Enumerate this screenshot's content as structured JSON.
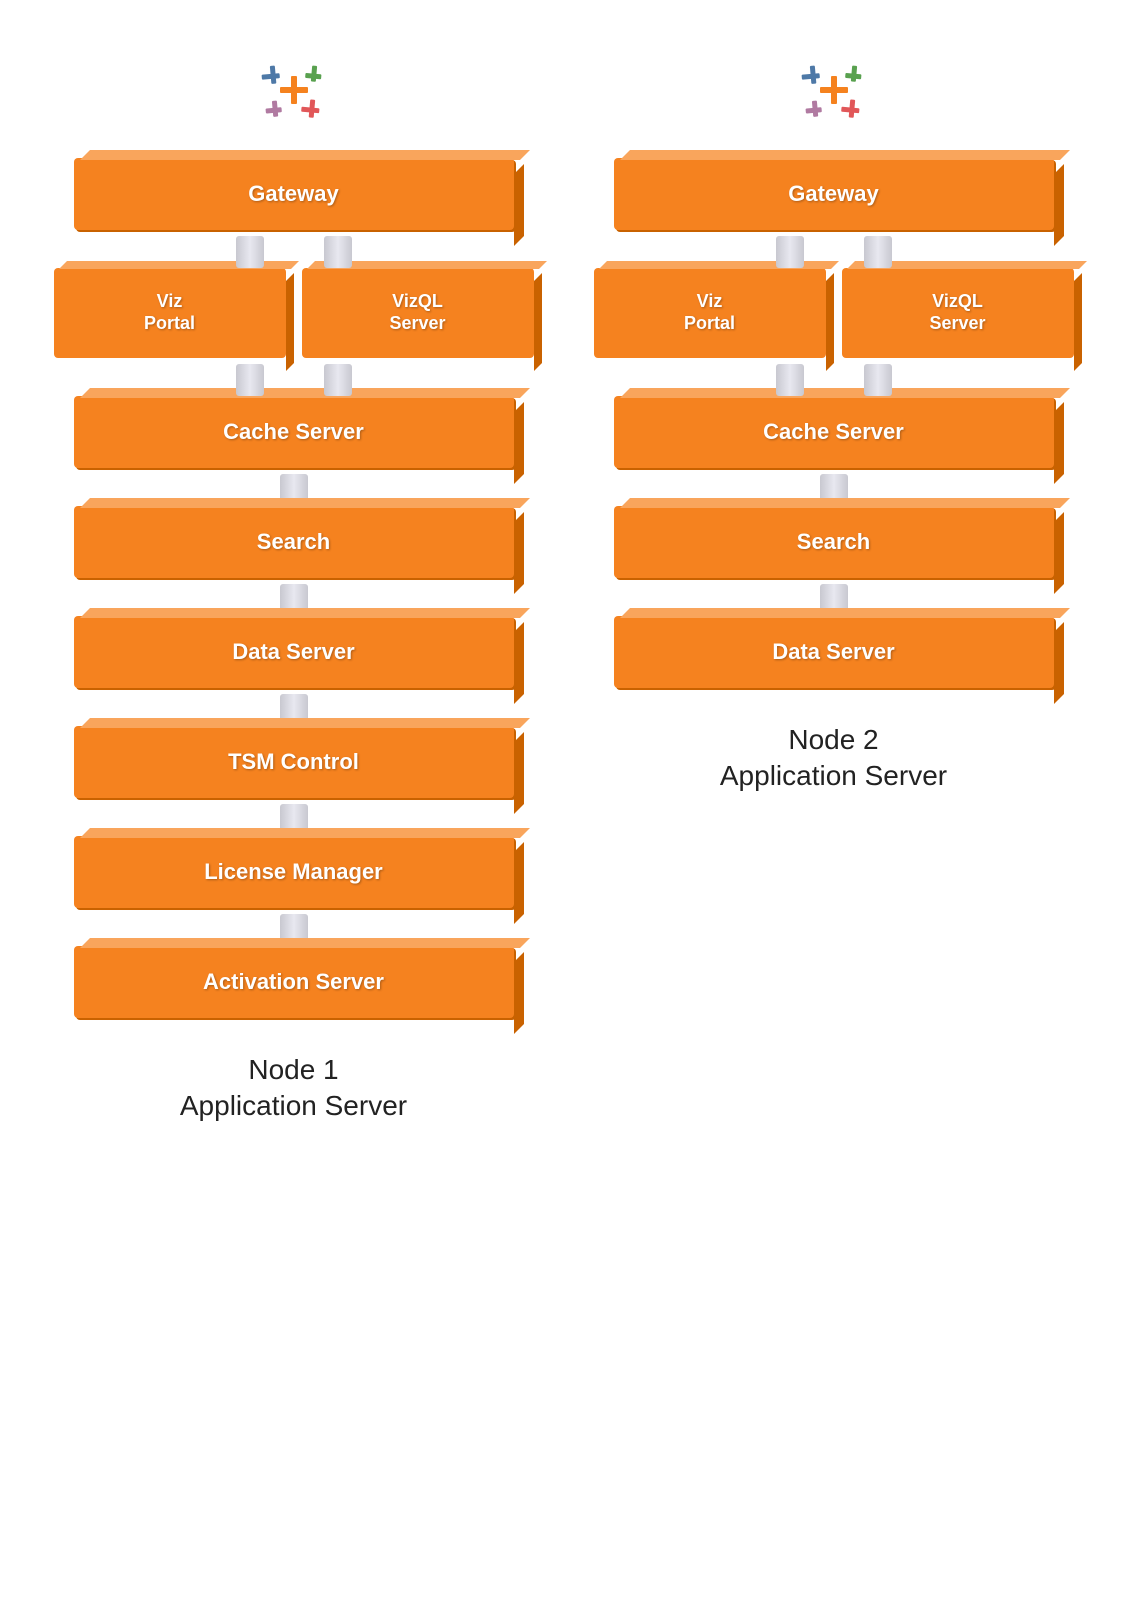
{
  "nodes": [
    {
      "id": "node1",
      "label_line1": "Node 1",
      "label_line2": "Application Server",
      "blocks": [
        {
          "id": "gateway",
          "label": "Gateway",
          "type": "main"
        },
        {
          "id": "viz-portal",
          "label": "Viz\nPortal",
          "type": "dual"
        },
        {
          "id": "vizql-server",
          "label": "VizQL\nServer",
          "type": "dual"
        },
        {
          "id": "cache-server",
          "label": "Cache Server",
          "type": "main"
        },
        {
          "id": "search",
          "label": "Search",
          "type": "main"
        },
        {
          "id": "data-server",
          "label": "Data Server",
          "type": "main"
        },
        {
          "id": "tsm-control",
          "label": "TSM Control",
          "type": "main"
        },
        {
          "id": "license-manager",
          "label": "License Manager",
          "type": "main"
        },
        {
          "id": "activation-server",
          "label": "Activation Server",
          "type": "main"
        }
      ]
    },
    {
      "id": "node2",
      "label_line1": "Node 2",
      "label_line2": "Application Server",
      "blocks": [
        {
          "id": "gateway",
          "label": "Gateway",
          "type": "main"
        },
        {
          "id": "viz-portal",
          "label": "Viz\nPortal",
          "type": "dual"
        },
        {
          "id": "vizql-server",
          "label": "VizQL\nServer",
          "type": "dual"
        },
        {
          "id": "cache-server",
          "label": "Cache Server",
          "type": "main"
        },
        {
          "id": "search",
          "label": "Search",
          "type": "main"
        },
        {
          "id": "data-server",
          "label": "Data Server",
          "type": "main"
        }
      ]
    }
  ],
  "logo": {
    "alt": "Tableau Logo"
  }
}
